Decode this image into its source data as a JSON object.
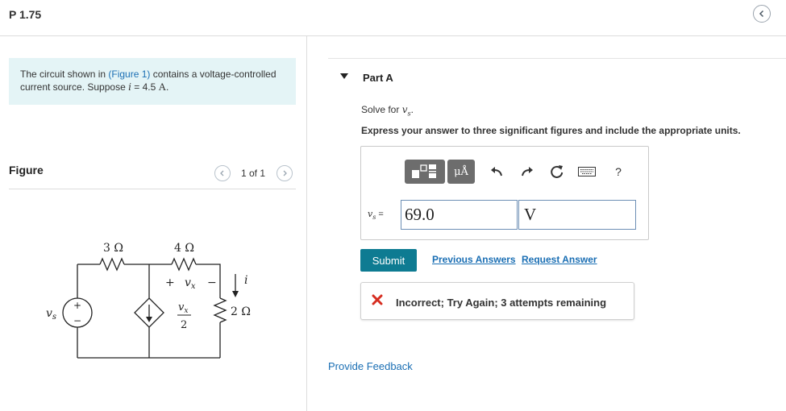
{
  "header": {
    "title": "P 1.75"
  },
  "problem": {
    "text_before": "The circuit shown in ",
    "figure_link": "(Figure 1)",
    "text_after": " contains a voltage-controlled current source. Suppose ",
    "variable": "i",
    "equals": " = 4.5 ",
    "unit": "A",
    "period": "."
  },
  "figure": {
    "label": "Figure",
    "pager": "1 of 1",
    "circuit": {
      "r1": "3 Ω",
      "r2": "4 Ω",
      "r3": "2 Ω",
      "source_label": "v",
      "source_sub": "s",
      "vx_plus": "+",
      "vx_minus": "−",
      "vx_label": "v",
      "vx_sub": "x",
      "dep_num_v": "v",
      "dep_num_sub": "x",
      "dep_den": "2",
      "current_label": "i",
      "src_plus": "+",
      "src_minus": "−"
    }
  },
  "part_a": {
    "title": "Part A",
    "solve_prefix": "Solve for ",
    "solve_var": "v",
    "solve_sub": "s",
    "solve_suffix": ".",
    "instructions": "Express your answer to three significant figures and include the appropriate units.",
    "toolbar": {
      "templates_icon": "templates-icon",
      "units_label": "μÅ",
      "help_label": "?"
    },
    "answer": {
      "var": "v",
      "var_sub": "s",
      "equals": " =",
      "value": "69.0",
      "units": "V"
    },
    "submit_label": "Submit",
    "previous_answers": "Previous Answers",
    "request_answer": "Request Answer",
    "feedback": {
      "status": "incorrect",
      "message": "Incorrect; Try Again; 3 attempts remaining",
      "color": "#d62d20"
    },
    "provide_feedback": "Provide Feedback"
  }
}
